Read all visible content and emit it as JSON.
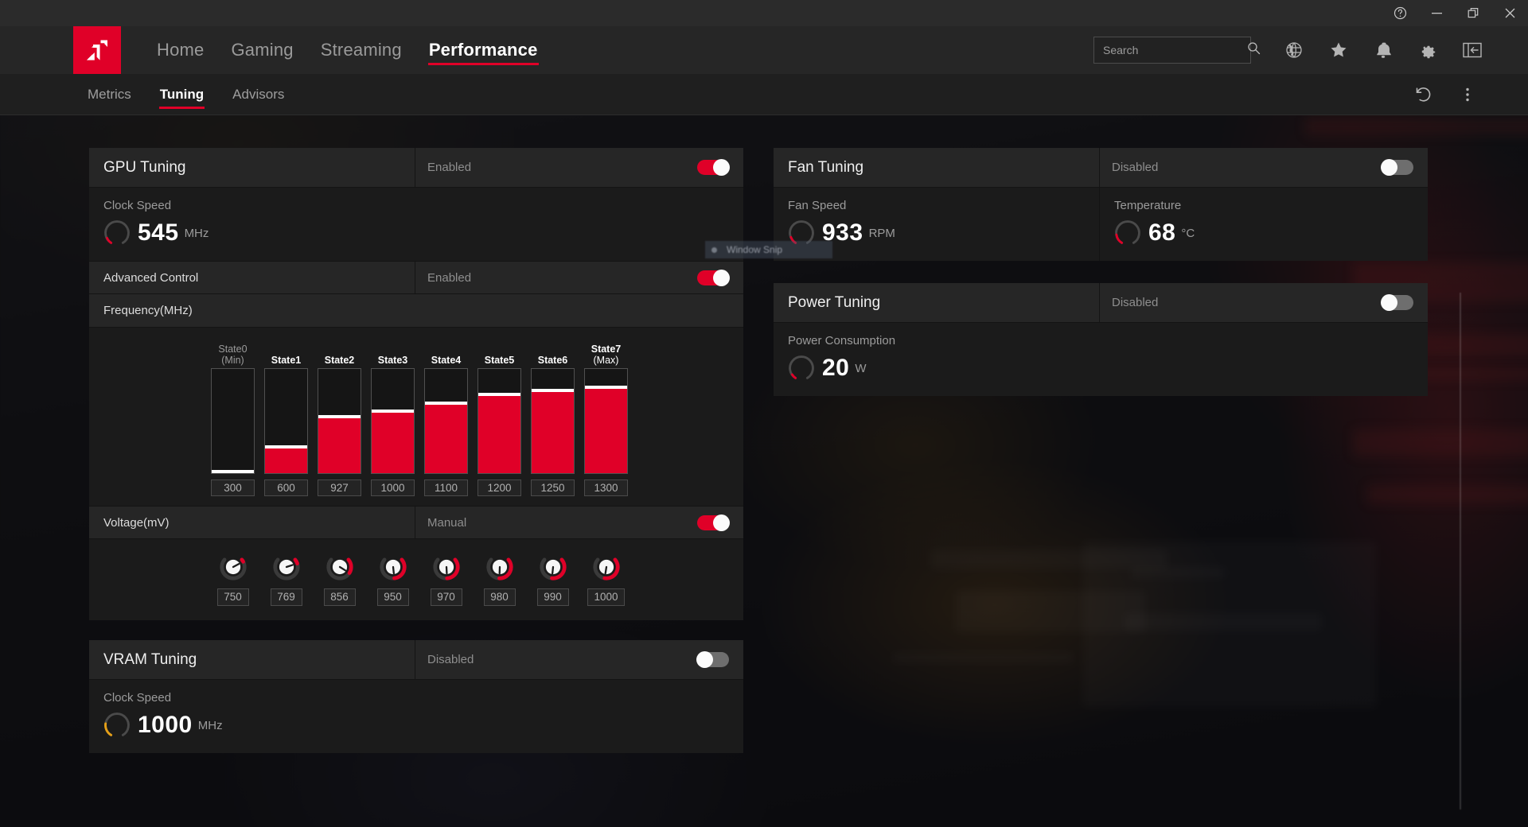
{
  "window": {
    "controls": [
      {
        "name": "help-button",
        "glyph": "?"
      },
      {
        "name": "minimize-button",
        "glyph": "—"
      },
      {
        "name": "restore-button",
        "glyph": "❐"
      },
      {
        "name": "close-button",
        "glyph": "✕"
      }
    ]
  },
  "brand": {
    "logo_alt": "AMD"
  },
  "nav": {
    "links": [
      {
        "label": "Home",
        "active": false
      },
      {
        "label": "Gaming",
        "active": false
      },
      {
        "label": "Streaming",
        "active": false
      },
      {
        "label": "Performance",
        "active": true
      }
    ],
    "search": {
      "value": "",
      "placeholder": "Search"
    },
    "icons": [
      "globe-icon",
      "star-icon",
      "bell-icon",
      "gear-icon",
      "panel-collapse-icon"
    ]
  },
  "subnav": {
    "tabs": [
      {
        "label": "Metrics",
        "active": false
      },
      {
        "label": "Tuning",
        "active": true
      },
      {
        "label": "Advisors",
        "active": false
      }
    ],
    "actions": [
      "reset-icon",
      "more-options-icon"
    ]
  },
  "gpu_tuning": {
    "title": "GPU Tuning",
    "state_label": "Enabled",
    "enabled": true,
    "clock_speed": {
      "label": "Clock Speed",
      "value": "545",
      "unit": "MHz",
      "gauge_percent": 16,
      "gauge_color": "#e00028"
    },
    "advanced_control": {
      "title": "Advanced Control",
      "state_label": "Enabled",
      "enabled": true
    },
    "frequency": {
      "section_label": "Frequency(MHz)",
      "states": [
        {
          "label": "State0",
          "sub": "(Min)",
          "value": "300",
          "fill_percent": 0,
          "dim": true
        },
        {
          "label": "State1",
          "sub": "",
          "value": "600",
          "fill_percent": 23,
          "dim": false
        },
        {
          "label": "State2",
          "sub": "",
          "value": "927",
          "fill_percent": 52,
          "dim": false
        },
        {
          "label": "State3",
          "sub": "",
          "value": "1000",
          "fill_percent": 57,
          "dim": false
        },
        {
          "label": "State4",
          "sub": "",
          "value": "1100",
          "fill_percent": 65,
          "dim": false
        },
        {
          "label": "State5",
          "sub": "",
          "value": "1200",
          "fill_percent": 73,
          "dim": false
        },
        {
          "label": "State6",
          "sub": "",
          "value": "1250",
          "fill_percent": 77,
          "dim": false
        },
        {
          "label": "State7",
          "sub": "(Max)",
          "value": "1300",
          "fill_percent": 80,
          "dim": false
        }
      ]
    },
    "voltage": {
      "title": "Voltage(mV)",
      "state_label": "Manual",
      "enabled": true,
      "knobs": [
        {
          "value": "750",
          "angle": -118
        },
        {
          "value": "769",
          "angle": -108
        },
        {
          "value": "856",
          "angle": -58
        },
        {
          "value": "950",
          "angle": -6
        },
        {
          "value": "970",
          "angle": -3
        },
        {
          "value": "980",
          "angle": 2
        },
        {
          "value": "990",
          "angle": 6
        },
        {
          "value": "1000",
          "angle": 9
        }
      ]
    }
  },
  "vram_tuning": {
    "title": "VRAM Tuning",
    "state_label": "Disabled",
    "enabled": false,
    "clock_speed": {
      "label": "Clock Speed",
      "value": "1000",
      "unit": "MHz",
      "gauge_percent": 42,
      "gauge_color": "#e5a017"
    }
  },
  "fan_tuning": {
    "title": "Fan Tuning",
    "state_label": "Disabled",
    "enabled": false,
    "fan_speed": {
      "label": "Fan Speed",
      "value": "933",
      "unit": "RPM",
      "gauge_percent": 17,
      "gauge_color": "#e00028"
    },
    "temperature": {
      "label": "Temperature",
      "value": "68",
      "unit": "°C",
      "gauge_percent": 22,
      "gauge_color": "#e00028"
    }
  },
  "power_tuning": {
    "title": "Power Tuning",
    "state_label": "Disabled",
    "enabled": false,
    "power_consumption": {
      "label": "Power Consumption",
      "value": "20",
      "unit": "W",
      "gauge_percent": 12,
      "gauge_color": "#e00028"
    }
  },
  "overlay": {
    "snip_tooltip": "Window Snip"
  },
  "colors": {
    "accent": "#e00028",
    "panel": "#1b1b1b",
    "header": "#262626",
    "vram_gauge": "#e5a017"
  }
}
